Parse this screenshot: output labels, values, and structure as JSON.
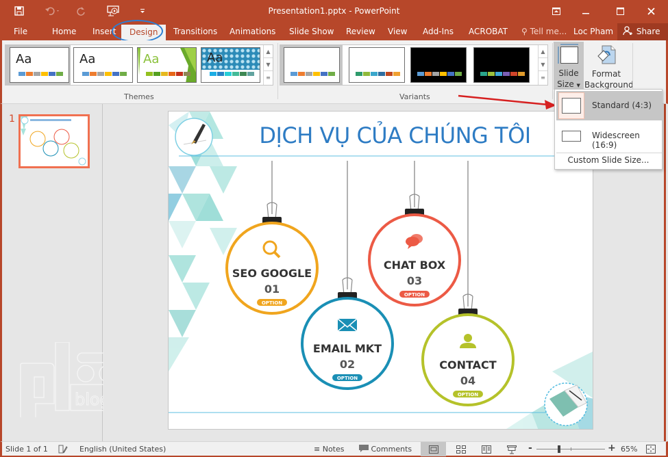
{
  "window": {
    "title": "Presentation1.pptx - PowerPoint",
    "buttons": [
      "ribbon-display-options",
      "minimize",
      "maximize",
      "close"
    ]
  },
  "quick_access": {
    "icons": [
      "save-icon",
      "undo-icon",
      "redo-icon",
      "start-from-beginning-icon",
      "customize-qat-icon"
    ]
  },
  "tabs": {
    "file": "File",
    "home": "Home",
    "insert": "Insert",
    "design": "Design",
    "transitions": "Transitions",
    "animations": "Animations",
    "slideshow": "Slide Show",
    "review": "Review",
    "view": "View",
    "addins": "Add-Ins",
    "acrobat": "ACROBAT",
    "tellme": "Tell me...",
    "user": "Loc Pham",
    "share": "Share",
    "active": "Design"
  },
  "ribbon": {
    "themes": {
      "label": "Themes",
      "items": [
        {
          "sample": "Aa",
          "colors": [
            "#5b9bd5",
            "#ed7d31",
            "#a5a5a5",
            "#ffc000",
            "#4472c4",
            "#70ad47"
          ]
        },
        {
          "sample": "Aa",
          "colors": [
            "#5b9bd5",
            "#ed7d31",
            "#a5a5a5",
            "#ffc000",
            "#4472c4",
            "#70ad47"
          ]
        },
        {
          "sample": "Aa",
          "colors": [
            "#93c01f",
            "#54a021",
            "#e6b91e",
            "#e76618",
            "#c42f1a",
            "#918655"
          ]
        },
        {
          "sample": "Aa",
          "colors": [
            "#1cade4",
            "#2683c6",
            "#27ced7",
            "#42ba97",
            "#3e8853",
            "#62a39f"
          ]
        }
      ]
    },
    "variants": {
      "label": "Variants",
      "items": [
        {
          "bg": "#ffffff",
          "colors": [
            "#5b9bd5",
            "#ed7d31",
            "#a5a5a5",
            "#ffc000",
            "#4472c4",
            "#70ad47"
          ]
        },
        {
          "bg": "#ffffff",
          "colors": [
            "#2e9b6c",
            "#8fba3b",
            "#3aa7cc",
            "#2f6ea0",
            "#c0471e",
            "#f0a030"
          ]
        },
        {
          "bg": "#000000",
          "colors": [
            "#5b9bd5",
            "#ed7d31",
            "#a5a5a5",
            "#ffc000",
            "#4472c4",
            "#70ad47"
          ]
        },
        {
          "bg": "#000000",
          "colors": [
            "#2aa58b",
            "#9cc13c",
            "#3fa9d6",
            "#7a5fb5",
            "#d0452a",
            "#e09a2a"
          ]
        }
      ]
    },
    "slide_size": {
      "line1": "Slide",
      "line2": "Size"
    },
    "format_background": {
      "line1": "Format",
      "line2": "Background"
    }
  },
  "slide_size_menu": {
    "items": [
      {
        "label": "Standard (4:3)",
        "highlighted": true
      },
      {
        "label": "Widescreen (16:9)",
        "highlighted": false
      }
    ],
    "custom": "Custom Slide Size..."
  },
  "thumbnail_panel": {
    "slide_number": "1"
  },
  "slide": {
    "title": "DỊCH VỤ CỦA CHÚNG TÔI",
    "services": [
      {
        "name": "SEO GOOGLE",
        "number": "01",
        "tag": "OPTION",
        "color": "#f0a51e",
        "icon": "search-icon"
      },
      {
        "name": "EMAIL MKT",
        "number": "02",
        "tag": "OPTION",
        "color": "#1a8fb5",
        "icon": "envelope-icon"
      },
      {
        "name": "CHAT BOX",
        "number": "03",
        "tag": "OPTION",
        "color": "#ec5a45",
        "icon": "chat-bubbles-icon"
      },
      {
        "name": "CONTACT",
        "number": "04",
        "tag": "OPTION",
        "color": "#b5c22a",
        "icon": "person-icon"
      }
    ],
    "title_color": "#2e7cc4"
  },
  "watermark": {
    "text": "blog"
  },
  "status": {
    "slide_info": "Slide 1 of 1",
    "language": "English (United States)",
    "notes": "Notes",
    "comments": "Comments",
    "zoom": "65%",
    "zoom_minus": "-",
    "zoom_plus": "+"
  },
  "accent": "#b7472a"
}
